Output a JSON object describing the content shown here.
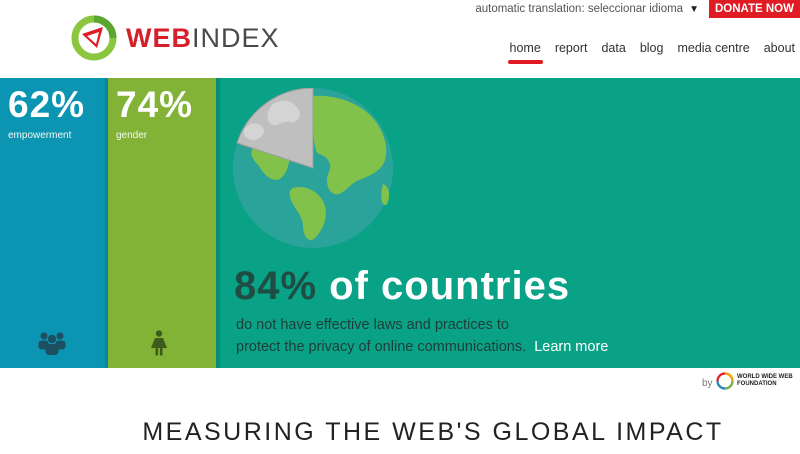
{
  "header": {
    "logo": {
      "web": "WEB",
      "index": "INDEX"
    },
    "translate_label": "automatic translation: seleccionar idioma",
    "translate_arrow": "▼",
    "donate_label": "DONATE NOW",
    "nav": [
      {
        "label": "home",
        "active": true
      },
      {
        "label": "report",
        "active": false
      },
      {
        "label": "data",
        "active": false
      },
      {
        "label": "blog",
        "active": false
      },
      {
        "label": "media centre",
        "active": false
      },
      {
        "label": "about",
        "active": false
      }
    ]
  },
  "hero": {
    "panels": [
      {
        "value": "62%",
        "label": "empowerment",
        "icon": "group-people-icon",
        "color": "#0b95b3"
      },
      {
        "value": "74%",
        "label": "gender",
        "icon": "woman-icon",
        "color": "#82b336"
      }
    ],
    "background_color": "#0aa286",
    "headline_number": "84%",
    "headline_rest": " of countries",
    "sub_line1": "do not have effective laws and practices to",
    "sub_line2": "protect the privacy of online communications.",
    "learn_more": "Learn more",
    "globe_icon": "globe-icon"
  },
  "footer": {
    "by": "by",
    "foundation_name": "WORLD WIDE WEB FOUNDATION",
    "tagline": "MEASURING THE WEB'S GLOBAL IMPACT"
  },
  "colors": {
    "accent_red": "#e01b24",
    "teal": "#0aa286",
    "blue": "#0b95b3",
    "green": "#82b336"
  }
}
